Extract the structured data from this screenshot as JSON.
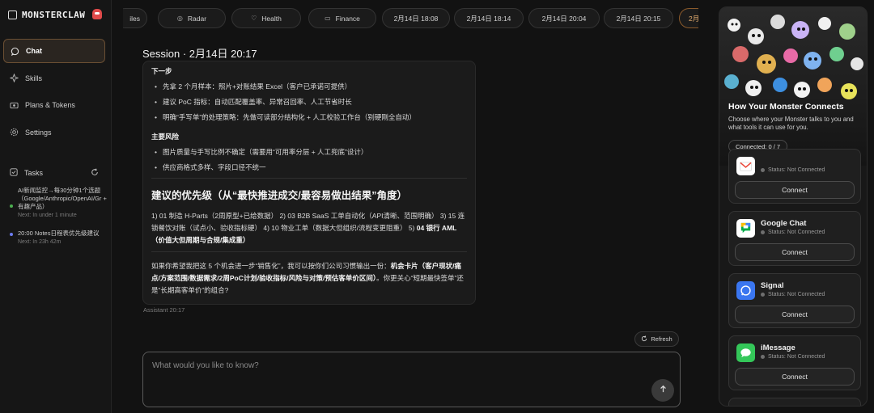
{
  "brand": {
    "name": "MONSTERCLAW"
  },
  "nav": [
    {
      "label": "Chat",
      "icon": "chat-bubble-icon"
    },
    {
      "label": "Skills",
      "icon": "sparkle-icon"
    },
    {
      "label": "Plans & Tokens",
      "icon": "token-icon"
    },
    {
      "label": "Settings",
      "icon": "gear-icon"
    }
  ],
  "tasks": {
    "label": "Tasks",
    "items": [
      {
        "title": "AI新闻监控→每30分钟1个选题（Google/Anthropic/OpenAI/Gr + 有趣产品）",
        "next": "Next: In under 1 minute",
        "dot_color": "#4caf50"
      },
      {
        "title": "20:00 Notes日程表优先级建议",
        "next": "Next: In 23h 42m",
        "dot_color": "#6c7cf0"
      }
    ]
  },
  "tabs": [
    {
      "label": "iles",
      "icon": ""
    },
    {
      "label": "Radar",
      "icon": "◎"
    },
    {
      "label": "Health",
      "icon": "♡"
    },
    {
      "label": "Finance",
      "icon": "▭"
    },
    {
      "label": "2月14日 18:08",
      "icon": ""
    },
    {
      "label": "2月14日 18:14",
      "icon": ""
    },
    {
      "label": "2月14日 20:04",
      "icon": ""
    },
    {
      "label": "2月14日 20:15",
      "icon": ""
    },
    {
      "label": "2月",
      "icon": ""
    }
  ],
  "session": {
    "title": "Session · 2月14日 20:17"
  },
  "message": {
    "next_steps_head": "下一步",
    "next_steps": [
      "先拿 2 个月样本：照片+对账结果 Excel（客户已承诺可提供）",
      "建议 PoC 指标：自动匹配覆盖率、异常召回率、人工节省时长",
      "明确“手写单”的处理策略：先做可读部分结构化 + 人工校验工作台（别硬刚全自动）"
    ],
    "risks_head": "主要风险",
    "risks": [
      "图片质量与手写比例不确定（需要用“可用率分层 + 人工兜底”设计）",
      "供应商格式多样、字段口径不统一"
    ],
    "priority_head": "建议的优先级（从“最快推进成交/最容易做出结果”角度）",
    "priority_text_1": "1) 01 制造 H-Parts（2周原型+已给数据） 2) 03 B2B SaaS 工单自动化（API清晰、范围明确） 3) 15 连锁餐饮对账（试点小、验收指标硬） 4) 10 物业工单（数据大但组织/流程变更阻重） 5) ",
    "priority_text_2": "04 银行 AML（价值大但周期与合规/集成重）",
    "closing_1": "如果你希望我把这 5 个机会进一步“销售化”，我可以按你们公司习惯输出一份：",
    "closing_bold": "机会卡片（客户现状/痛点/方案范围/数据需求/2周PoC计划/验收指标/风险与对策/预估客单价区间）",
    "closing_2": "。你更关心“短期最快签单”还是“长期高客单价”的组合?"
  },
  "message_meta": "Assistant 20:17",
  "refresh_label": "Refresh",
  "composer": {
    "placeholder": "What would you like to know?"
  },
  "panel": {
    "title": "How Your Monster Connects",
    "subtitle": "Choose where your Monster talks to you and what tools it can use for you.",
    "connected": "Connected: 0 / 7",
    "cards": [
      {
        "name": "",
        "status": "Status: Not Connected",
        "button": "Connect",
        "icon": "gmail-icon",
        "color": "#ffffff"
      },
      {
        "name": "Google Chat",
        "status": "Status: Not Connected",
        "button": "Connect",
        "icon": "google-chat-icon",
        "color": "#ffffff"
      },
      {
        "name": "Signal",
        "status": "Status: Not Connected",
        "button": "Connect",
        "icon": "signal-icon",
        "color": "#3a76f0"
      },
      {
        "name": "iMessage",
        "status": "Status: Not Connected",
        "button": "Connect",
        "icon": "imessage-icon",
        "color": "#34c759"
      }
    ]
  }
}
